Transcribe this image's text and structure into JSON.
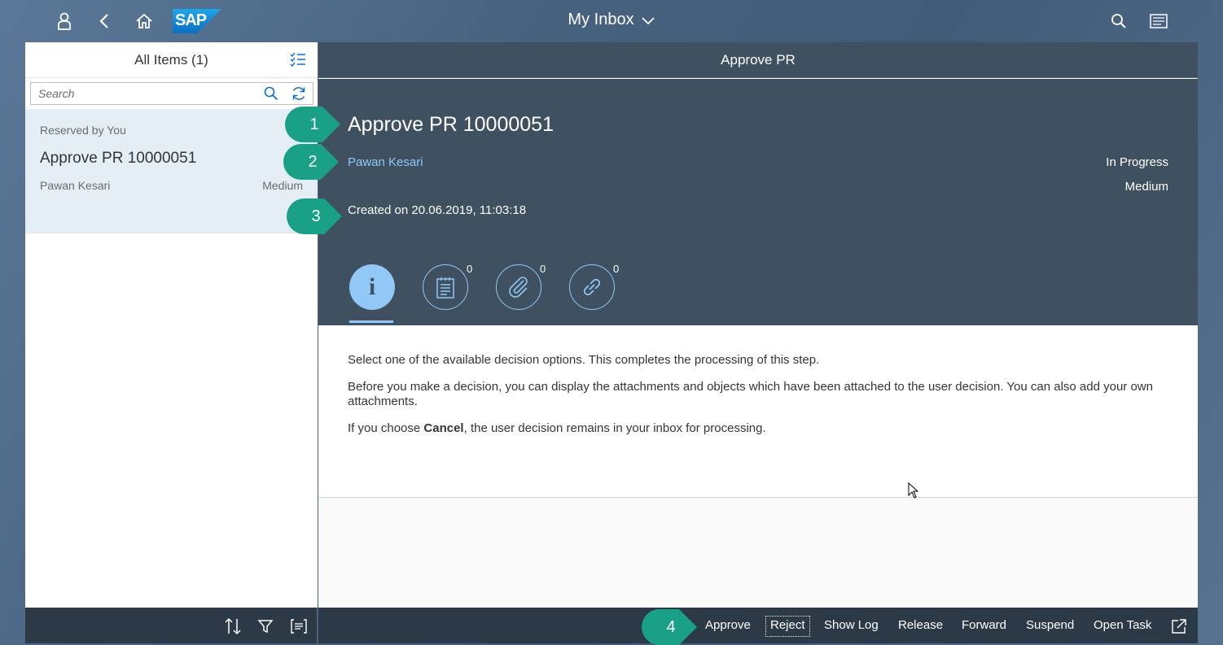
{
  "shell": {
    "title": "My Inbox",
    "logo_text": "SAP",
    "icons": [
      "user-icon",
      "back-icon",
      "home-icon",
      "search-icon",
      "notifications-icon"
    ]
  },
  "master": {
    "title": "All Items (1)",
    "search_placeholder": "Search",
    "item": {
      "group": "Reserved by You",
      "title": "Approve PR 10000051",
      "creator": "Pawan Kesari",
      "priority": "Medium"
    }
  },
  "detail": {
    "titlebar": "Approve PR",
    "header": {
      "title": "Approve PR 10000051",
      "creator": "Pawan Kesari",
      "status": "In Progress",
      "priority": "Medium",
      "created": "Created on 20.06.2019, 11:03:18"
    },
    "tabs": [
      {
        "icon": "info-icon",
        "count": ""
      },
      {
        "icon": "notes-icon",
        "count": "0"
      },
      {
        "icon": "attachment-icon",
        "count": "0"
      },
      {
        "icon": "link-icon",
        "count": "0"
      }
    ],
    "description": {
      "p1": "Select one of the available decision options. This completes the processing of this step.",
      "p2": "Before you make a decision, you can display the attachments and objects which have been attached to the user decision. You can also add your own attachments.",
      "p3_before": "If you choose ",
      "p3_bold": "Cancel",
      "p3_after": ", the user decision remains in your inbox for processing."
    }
  },
  "footer_actions": {
    "approve": "Approve",
    "reject": "Reject",
    "show_log": "Show Log",
    "release": "Release",
    "forward": "Forward",
    "suspend": "Suspend",
    "open_task": "Open Task"
  },
  "callouts": {
    "c1": "1",
    "c2": "2",
    "c3": "3",
    "c4": "4"
  },
  "colors": {
    "callout": "#1aa086",
    "header_bg": "#3f5161",
    "link": "#91c8f6",
    "footer_bg": "#2c3a48"
  }
}
